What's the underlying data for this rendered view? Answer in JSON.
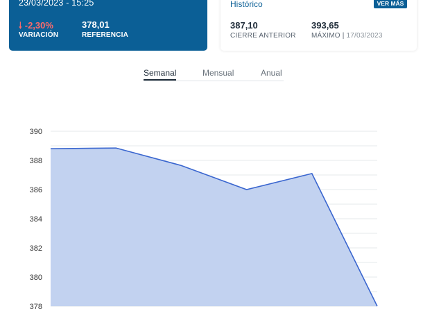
{
  "quote": {
    "timestamp": "23/03/2023 - 15:25",
    "variation_value": "-2,30%",
    "variation_label": "VARIACIÓN",
    "reference_value": "378,01",
    "reference_label": "REFERENCIA"
  },
  "history": {
    "title": "Histórico",
    "more_label": "VER MÁS",
    "prev_close_value": "387,10",
    "prev_close_label": "CIERRE ANTERIOR",
    "max_value": "393,65",
    "max_label_prefix": "MÁXIMO |",
    "max_date": "17/03/2023"
  },
  "tabs": [
    "Semanal",
    "Mensual",
    "Anual"
  ],
  "active_tab": "Semanal",
  "colors": {
    "brand_blue": "#0b5f96",
    "negative": "#ff6b6b",
    "line": "#3a66cf",
    "area": "#c2d2f0"
  },
  "chart_data": {
    "type": "area",
    "x": [
      1,
      2,
      3,
      4,
      5,
      6
    ],
    "values": [
      388.8,
      388.85,
      387.65,
      386.0,
      387.1,
      378.0
    ],
    "y_ticks": [
      390,
      388,
      386,
      384,
      382,
      380,
      378
    ],
    "ylim": [
      378,
      390
    ],
    "grid": true
  }
}
